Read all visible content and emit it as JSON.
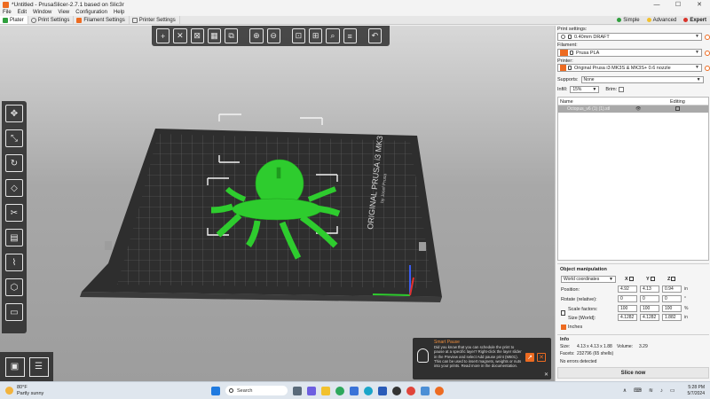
{
  "window": {
    "title": "*Untitled - PrusaSlicer-2.7.1 based on Slic3r",
    "minimize": "—",
    "maximize": "☐",
    "close": "✕"
  },
  "menu": [
    "File",
    "Edit",
    "Window",
    "View",
    "Configuration",
    "Help"
  ],
  "tabs": [
    {
      "label": "Plater",
      "color": "#2f9f3d",
      "active": true
    },
    {
      "label": "Print Settings",
      "color": "#6c6c6c"
    },
    {
      "label": "Filament Settings",
      "color": "#ed6b21"
    },
    {
      "label": "Printer Settings",
      "color": "#6c6c6c"
    }
  ],
  "modes": [
    {
      "label": "Simple",
      "color": "#2f9f3d"
    },
    {
      "label": "Advanced",
      "color": "#f2c12e"
    },
    {
      "label": "Expert",
      "color": "#d9342b"
    }
  ],
  "bed": {
    "logo_text": "ORIGINAL PRUSA i3 MK3",
    "logo_sub": "by Josef Prusa",
    "model_color": "#2ecc2e"
  },
  "sidebar": {
    "print_settings_label": "Print settings:",
    "print_settings_value": "0.40mm DRAFT",
    "filament_label": "Filament:",
    "filament_value": "Prusa PLA",
    "filament_color": "#ed6b21",
    "printer_label": "Printer:",
    "printer_value": "Original Prusa i3 MK3S & MK3S+ 0.6 nozzle",
    "supports_label": "Supports:",
    "supports_value": "None",
    "infill_label": "Infill:",
    "infill_value": "15%",
    "brim_label": "Brim:"
  },
  "object_list": {
    "col_name": "Name",
    "col_editing": "Editing",
    "rows": [
      {
        "name": "Octopus_v6 (1) (1).stl"
      }
    ]
  },
  "manipulation": {
    "title": "Object manipulation",
    "coords": "World coordinates",
    "axes": [
      "X",
      "Y",
      "Z"
    ],
    "position_label": "Position:",
    "position": [
      "4.92",
      "4.13",
      "0.94"
    ],
    "position_unit": "in",
    "rotate_label": "Rotate (relative):",
    "rotate": [
      "0",
      "0",
      "0"
    ],
    "rotate_unit": "°",
    "scale_label": "Scale factors:",
    "scale": [
      "100",
      "100",
      "100"
    ],
    "scale_unit": "%",
    "size_label": "Size [World]:",
    "size": [
      "4.1282",
      "4.1282",
      "1.882"
    ],
    "size_unit": "in",
    "inches_label": "Inches"
  },
  "info": {
    "title": "Info",
    "size_label": "Size:",
    "size_value": "4.13 x 4.13 x 1.88",
    "volume_label": "Volume:",
    "volume_value": "3.29",
    "facets_label": "Facets:",
    "facets_value": "232796 (65 shells)",
    "errors": "No errors detected"
  },
  "slice_button": "Slice now",
  "hint": {
    "title": "Smart Pause",
    "text": "Did you know that you can schedule the print to pause at a specific layer? Right-click the layer slider in the Preview and select Add pause print (M601). This can be used to insert magnets, weights or nuts into your prints. Read more in the documentation.",
    "close": "✕"
  },
  "taskbar": {
    "temp": "80°F",
    "weather": "Partly sunny",
    "search": "Search",
    "time": "5:28 PM",
    "date": "5/7/2024"
  }
}
